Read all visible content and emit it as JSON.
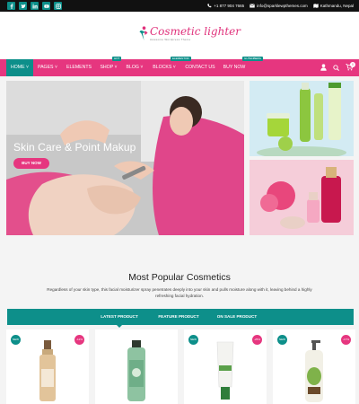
{
  "topbar": {
    "social_icons": [
      "facebook-icon",
      "twitter-icon",
      "linkedin-icon",
      "youtube-icon",
      "instagram-icon"
    ],
    "phone": "+1 877 904 7665",
    "email": "info@sparklewpthemes.com",
    "location": "Kathmandu, Nepal"
  },
  "logo": {
    "name": "Cosmetic lighter",
    "tagline": "Awesome Wordpress Theme"
  },
  "nav": {
    "items": [
      {
        "label": "HOME",
        "badge": ""
      },
      {
        "label": "PAGES",
        "badge": ""
      },
      {
        "label": "ELEMENTS",
        "badge": ""
      },
      {
        "label": "SHOP",
        "badge": "HOT"
      },
      {
        "label": "BLOG",
        "badge": ""
      },
      {
        "label": "BLOCKS",
        "badge": "ELEMENTOR"
      },
      {
        "label": "CONTACT US",
        "badge": ""
      },
      {
        "label": "BUY NOW",
        "badge": "GUTENBERG"
      }
    ],
    "cart_count": "0"
  },
  "hero": {
    "title": "Skin Care & Point Makup",
    "button": "BUY NOW"
  },
  "section": {
    "title": "Most Popular Cosmetics",
    "description": "Regardless of your skin type, this facial moisturizer spray penetrates deeply into your skin and pulls moisture along with it, leaving behind a highly refreshing facial hydration.",
    "tabs": [
      "LATEST PRODUCT",
      "FEATURE PRODUCT",
      "ON SALE PRODUCT"
    ]
  },
  "products": [
    {
      "new_label": "NEW",
      "sale_label": "-12%"
    },
    {
      "new_label": "NEW",
      "sale_label": "-19%"
    },
    {
      "new_label": "NEW",
      "sale_label": "-25%"
    },
    {
      "new_label": "NEW",
      "sale_label": "-17%"
    }
  ],
  "colors": {
    "brand_pink": "#e6367f",
    "accent_teal": "#0d8f8a",
    "topbar": "#111111"
  }
}
